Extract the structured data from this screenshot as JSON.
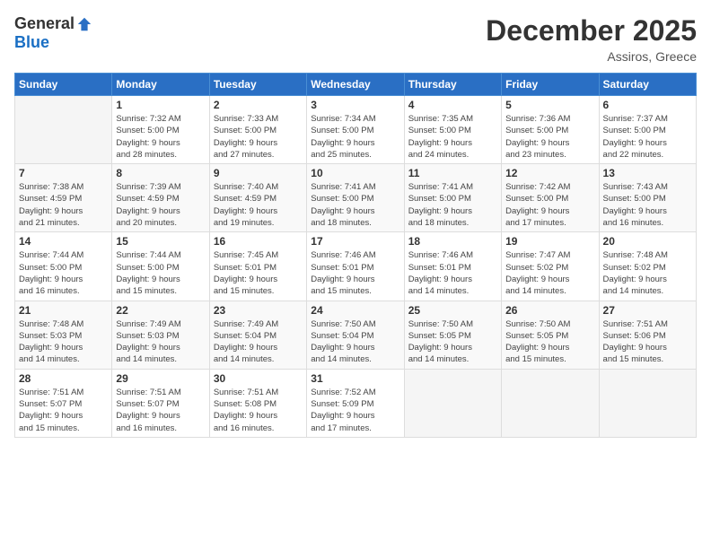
{
  "logo": {
    "general": "General",
    "blue": "Blue"
  },
  "title": "December 2025",
  "subtitle": "Assiros, Greece",
  "weekdays": [
    "Sunday",
    "Monday",
    "Tuesday",
    "Wednesday",
    "Thursday",
    "Friday",
    "Saturday"
  ],
  "weeks": [
    [
      {
        "day": "",
        "info": ""
      },
      {
        "day": "1",
        "info": "Sunrise: 7:32 AM\nSunset: 5:00 PM\nDaylight: 9 hours\nand 28 minutes."
      },
      {
        "day": "2",
        "info": "Sunrise: 7:33 AM\nSunset: 5:00 PM\nDaylight: 9 hours\nand 27 minutes."
      },
      {
        "day": "3",
        "info": "Sunrise: 7:34 AM\nSunset: 5:00 PM\nDaylight: 9 hours\nand 25 minutes."
      },
      {
        "day": "4",
        "info": "Sunrise: 7:35 AM\nSunset: 5:00 PM\nDaylight: 9 hours\nand 24 minutes."
      },
      {
        "day": "5",
        "info": "Sunrise: 7:36 AM\nSunset: 5:00 PM\nDaylight: 9 hours\nand 23 minutes."
      },
      {
        "day": "6",
        "info": "Sunrise: 7:37 AM\nSunset: 5:00 PM\nDaylight: 9 hours\nand 22 minutes."
      }
    ],
    [
      {
        "day": "7",
        "info": "Sunrise: 7:38 AM\nSunset: 4:59 PM\nDaylight: 9 hours\nand 21 minutes."
      },
      {
        "day": "8",
        "info": "Sunrise: 7:39 AM\nSunset: 4:59 PM\nDaylight: 9 hours\nand 20 minutes."
      },
      {
        "day": "9",
        "info": "Sunrise: 7:40 AM\nSunset: 4:59 PM\nDaylight: 9 hours\nand 19 minutes."
      },
      {
        "day": "10",
        "info": "Sunrise: 7:41 AM\nSunset: 5:00 PM\nDaylight: 9 hours\nand 18 minutes."
      },
      {
        "day": "11",
        "info": "Sunrise: 7:41 AM\nSunset: 5:00 PM\nDaylight: 9 hours\nand 18 minutes."
      },
      {
        "day": "12",
        "info": "Sunrise: 7:42 AM\nSunset: 5:00 PM\nDaylight: 9 hours\nand 17 minutes."
      },
      {
        "day": "13",
        "info": "Sunrise: 7:43 AM\nSunset: 5:00 PM\nDaylight: 9 hours\nand 16 minutes."
      }
    ],
    [
      {
        "day": "14",
        "info": "Sunrise: 7:44 AM\nSunset: 5:00 PM\nDaylight: 9 hours\nand 16 minutes."
      },
      {
        "day": "15",
        "info": "Sunrise: 7:44 AM\nSunset: 5:00 PM\nDaylight: 9 hours\nand 15 minutes."
      },
      {
        "day": "16",
        "info": "Sunrise: 7:45 AM\nSunset: 5:01 PM\nDaylight: 9 hours\nand 15 minutes."
      },
      {
        "day": "17",
        "info": "Sunrise: 7:46 AM\nSunset: 5:01 PM\nDaylight: 9 hours\nand 15 minutes."
      },
      {
        "day": "18",
        "info": "Sunrise: 7:46 AM\nSunset: 5:01 PM\nDaylight: 9 hours\nand 14 minutes."
      },
      {
        "day": "19",
        "info": "Sunrise: 7:47 AM\nSunset: 5:02 PM\nDaylight: 9 hours\nand 14 minutes."
      },
      {
        "day": "20",
        "info": "Sunrise: 7:48 AM\nSunset: 5:02 PM\nDaylight: 9 hours\nand 14 minutes."
      }
    ],
    [
      {
        "day": "21",
        "info": "Sunrise: 7:48 AM\nSunset: 5:03 PM\nDaylight: 9 hours\nand 14 minutes."
      },
      {
        "day": "22",
        "info": "Sunrise: 7:49 AM\nSunset: 5:03 PM\nDaylight: 9 hours\nand 14 minutes."
      },
      {
        "day": "23",
        "info": "Sunrise: 7:49 AM\nSunset: 5:04 PM\nDaylight: 9 hours\nand 14 minutes."
      },
      {
        "day": "24",
        "info": "Sunrise: 7:50 AM\nSunset: 5:04 PM\nDaylight: 9 hours\nand 14 minutes."
      },
      {
        "day": "25",
        "info": "Sunrise: 7:50 AM\nSunset: 5:05 PM\nDaylight: 9 hours\nand 14 minutes."
      },
      {
        "day": "26",
        "info": "Sunrise: 7:50 AM\nSunset: 5:05 PM\nDaylight: 9 hours\nand 15 minutes."
      },
      {
        "day": "27",
        "info": "Sunrise: 7:51 AM\nSunset: 5:06 PM\nDaylight: 9 hours\nand 15 minutes."
      }
    ],
    [
      {
        "day": "28",
        "info": "Sunrise: 7:51 AM\nSunset: 5:07 PM\nDaylight: 9 hours\nand 15 minutes."
      },
      {
        "day": "29",
        "info": "Sunrise: 7:51 AM\nSunset: 5:07 PM\nDaylight: 9 hours\nand 16 minutes."
      },
      {
        "day": "30",
        "info": "Sunrise: 7:51 AM\nSunset: 5:08 PM\nDaylight: 9 hours\nand 16 minutes."
      },
      {
        "day": "31",
        "info": "Sunrise: 7:52 AM\nSunset: 5:09 PM\nDaylight: 9 hours\nand 17 minutes."
      },
      {
        "day": "",
        "info": ""
      },
      {
        "day": "",
        "info": ""
      },
      {
        "day": "",
        "info": ""
      }
    ]
  ]
}
